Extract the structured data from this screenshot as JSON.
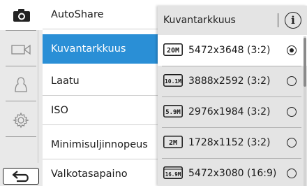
{
  "menu": {
    "items": [
      {
        "label": "AutoShare"
      },
      {
        "label": "Kuvantarkkuus"
      },
      {
        "label": "Laatu"
      },
      {
        "label": "ISO"
      },
      {
        "label": "Minimisuljinnopeus"
      },
      {
        "label": "Valkotasapaino"
      }
    ],
    "selected_index": 1
  },
  "popup": {
    "title": "Kuvantarkkuus",
    "info_glyph": "i",
    "options": [
      {
        "badge": "20M",
        "resolution": "5472x3648 (3:2)",
        "selected": true
      },
      {
        "badge": "10.1M",
        "resolution": "3888x2592 (3:2)",
        "selected": false
      },
      {
        "badge": "5.9M",
        "resolution": "2976x1984 (3:2)",
        "selected": false
      },
      {
        "badge": "2M",
        "resolution": "1728x1152 (3:2)",
        "selected": false
      },
      {
        "badge": "16.9M",
        "resolution": "5472x3080 (16:9)",
        "selected": false
      }
    ]
  },
  "tabs": {
    "items": [
      "camera-icon",
      "video-icon",
      "person-icon",
      "gear-icon"
    ],
    "active_index": 0
  },
  "colors": {
    "accent": "#2a8fd6",
    "popup_bg": "#e4e4e4",
    "tab_bg": "#e9e9e9"
  }
}
